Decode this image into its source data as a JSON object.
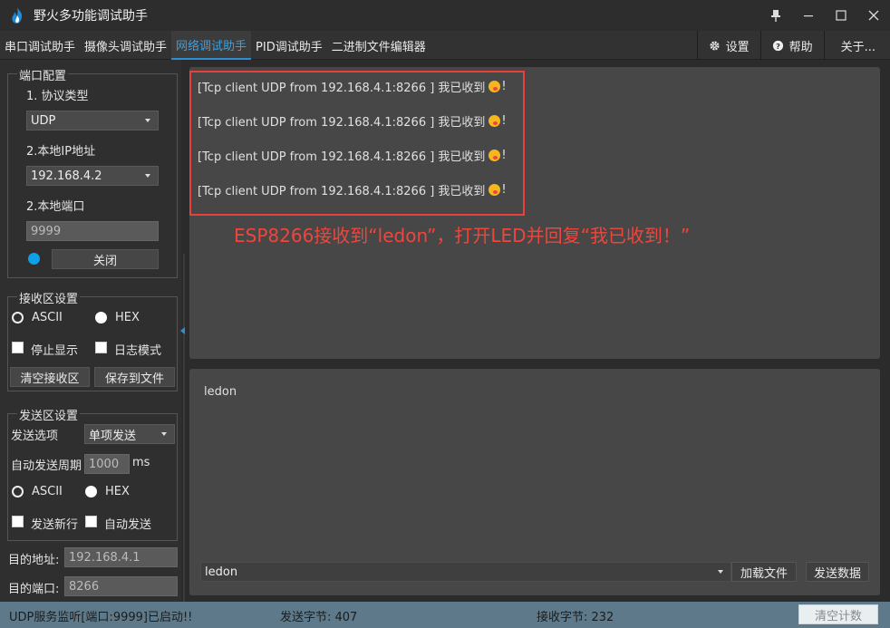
{
  "window": {
    "title": "野火多功能调试助手",
    "controls": [
      "📌",
      "—",
      "☐",
      "✕"
    ]
  },
  "tabs": [
    {
      "label": "串口调试助手",
      "active": false
    },
    {
      "label": "摄像头调试助手",
      "active": false
    },
    {
      "label": "网络调试助手",
      "active": true
    },
    {
      "label": "PID调试助手",
      "active": false
    },
    {
      "label": "二进制文件编辑器",
      "active": false
    }
  ],
  "right_tabs": {
    "settings": "设置",
    "help": "帮助",
    "about": "关于..."
  },
  "port_config": {
    "title": "端口配置",
    "protocol_label": "1. 协议类型",
    "protocol_value": "UDP",
    "local_ip_label": "2.本地IP地址",
    "local_ip_value": "192.168.4.2",
    "local_port_label": "2.本地端口",
    "local_port_value": "9999",
    "close_button": "关闭"
  },
  "recv_settings": {
    "title": "接收区设置",
    "ascii": "ASCII",
    "hex": "HEX",
    "stop_display": "停止显示",
    "log_mode": "日志模式",
    "clear_recv": "清空接收区",
    "save_to_file": "保存到文件"
  },
  "send_settings": {
    "title": "发送区设置",
    "send_option_label": "发送选项",
    "send_option_value": "单项发送",
    "auto_period_label": "自动发送周期",
    "auto_period_value": "1000",
    "auto_period_unit": "ms",
    "ascii": "ASCII",
    "hex": "HEX",
    "send_newline": "发送新行",
    "auto_send": "自动发送"
  },
  "target": {
    "addr_label": "目的地址:",
    "addr_value": "192.168.4.1",
    "port_label": "目的端口:",
    "port_value": "8266"
  },
  "receive": {
    "lines": [
      {
        "text": "[Tcp client  UDP from 192.168.4.1:8266 ] 我已收到",
        "suffix": "!"
      },
      {
        "text": "[Tcp client  UDP from 192.168.4.1:8266 ] 我已收到",
        "suffix": "!"
      },
      {
        "text": "[Tcp client  UDP from 192.168.4.1:8266 ] 我已收到",
        "suffix": "!"
      },
      {
        "text": "[Tcp client  UDP from 192.168.4.1:8266 ] 我已收到",
        "suffix": "!"
      }
    ],
    "annotation": "ESP8266接收到“ledon”，打开LED并回复“我已收到！”",
    "highlight_color": "#e8403c"
  },
  "send": {
    "text": "ledon",
    "combo_value": "ledon",
    "load_file": "加载文件",
    "send_data": "发送数据"
  },
  "status": {
    "message": "UDP服务监听[端口:9999]已启动!!",
    "sent_bytes": "发送字节: 407",
    "recv_bytes": "接收字节: 232",
    "clear_count": "清空计数"
  },
  "colors": {
    "accent": "#2b8fd6",
    "status_bar": "#5e7a8a"
  }
}
